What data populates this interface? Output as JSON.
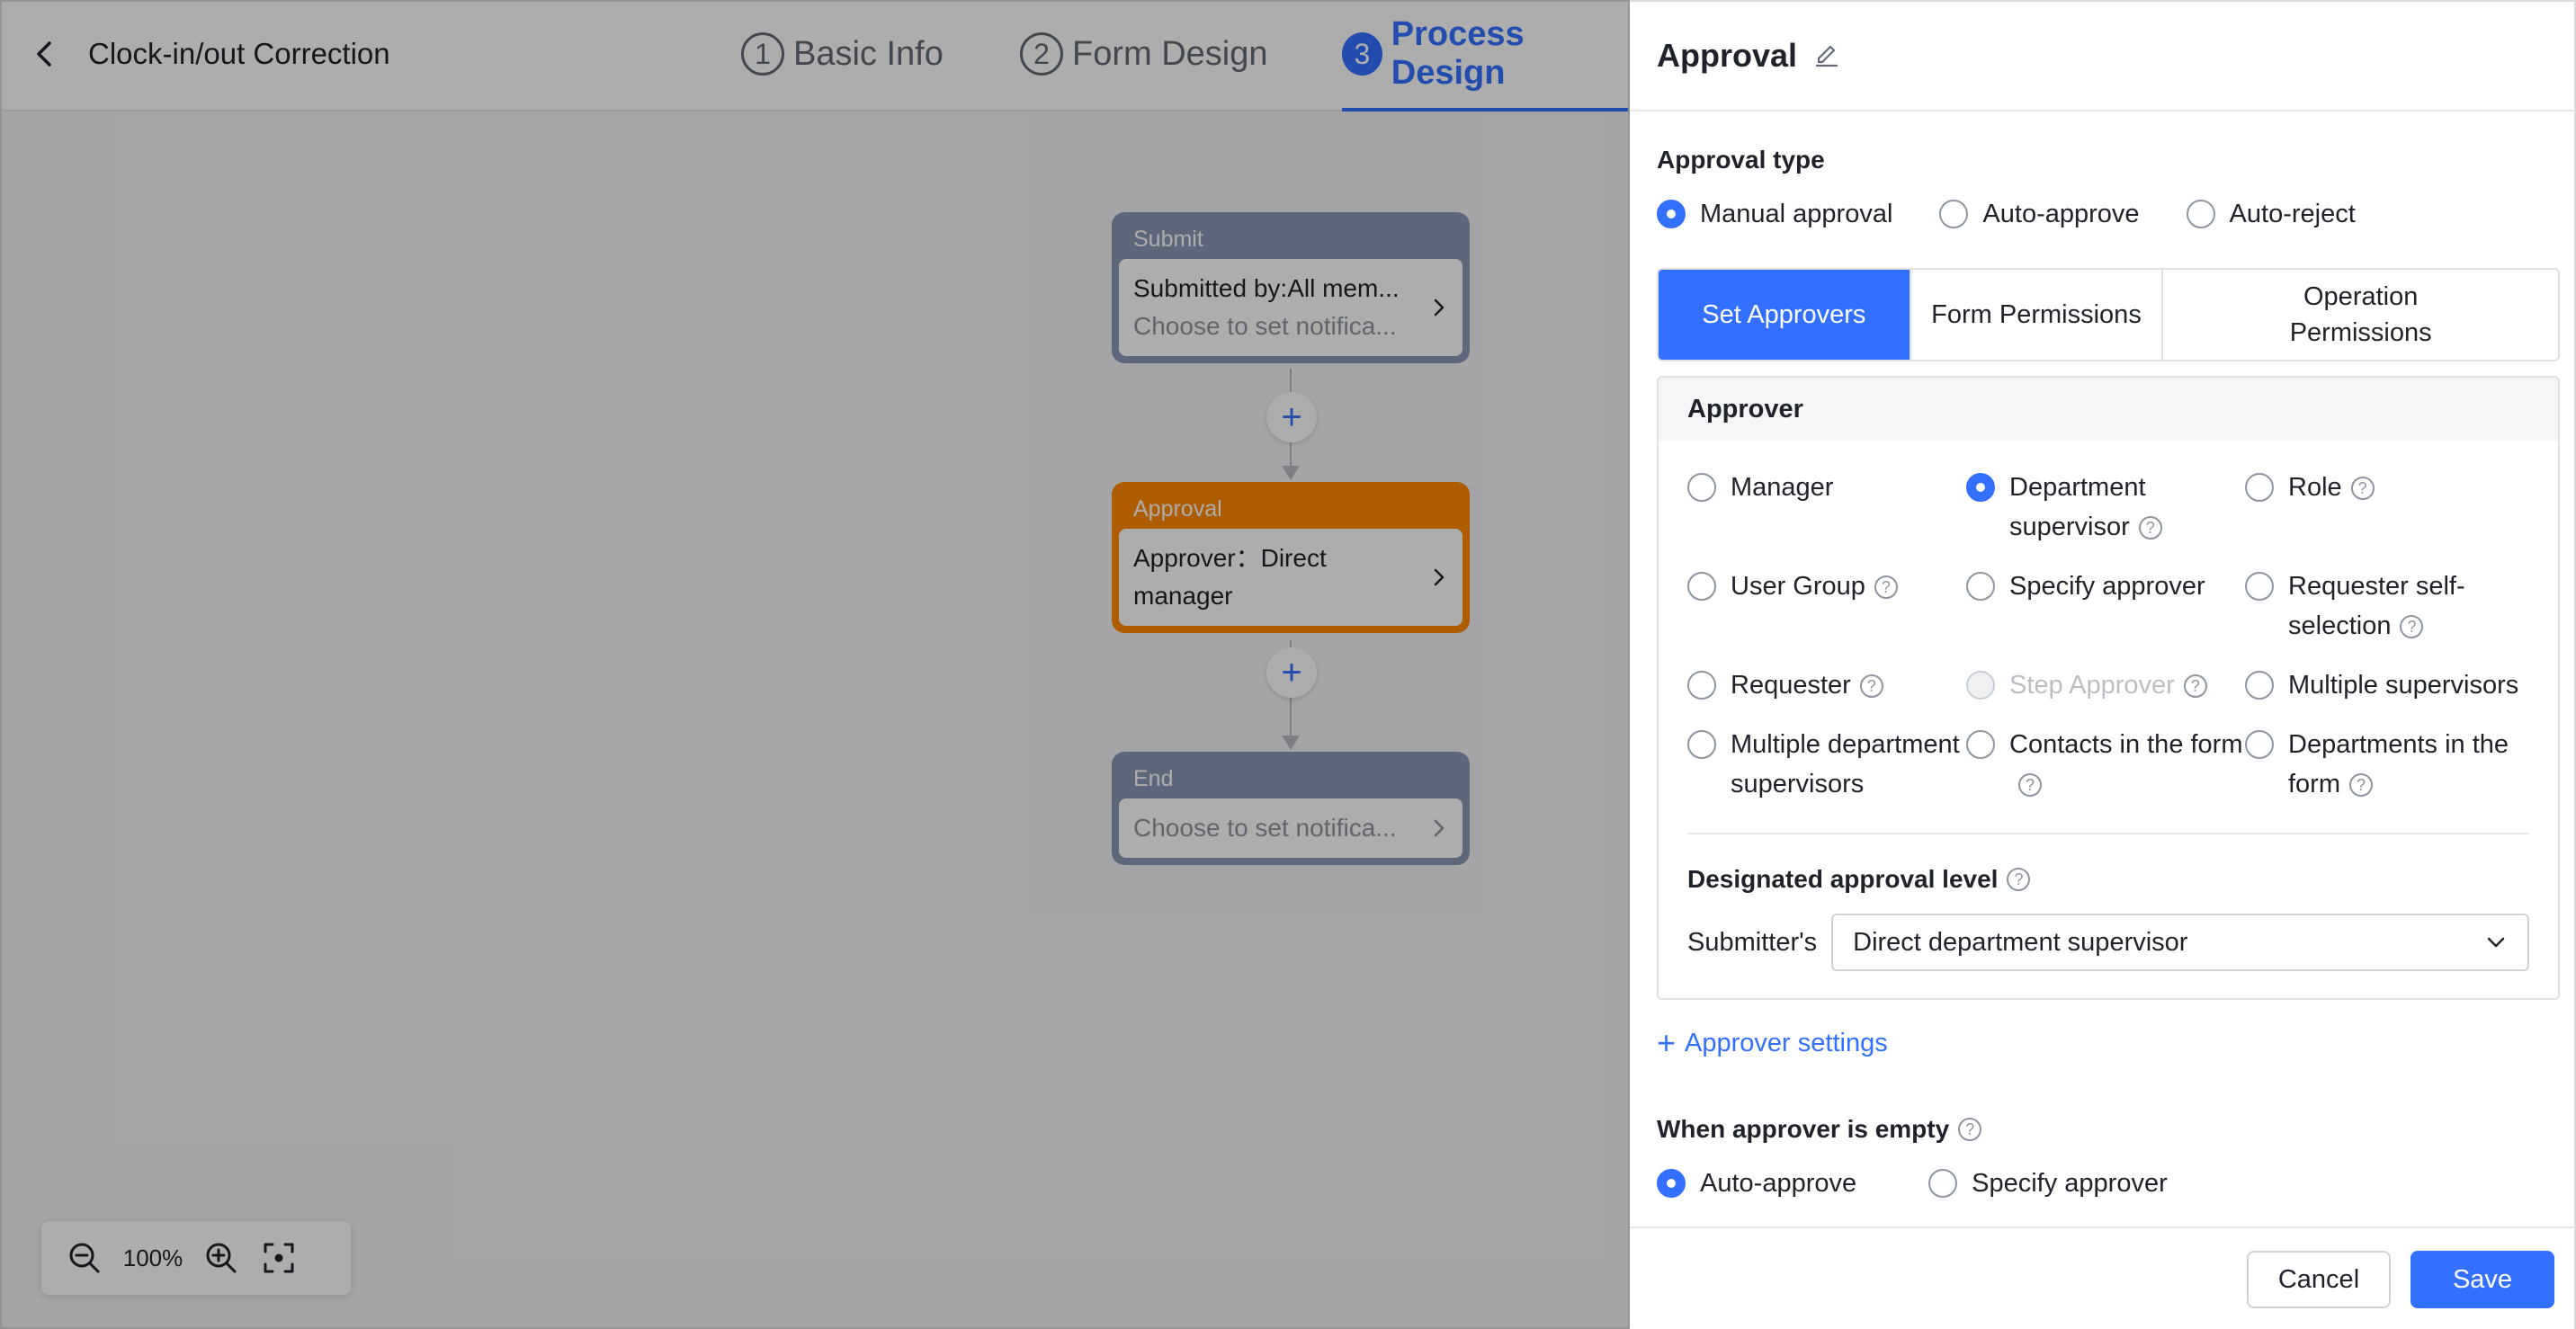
{
  "header": {
    "title": "Clock-in/out Correction",
    "steps": [
      {
        "num": "1",
        "label": "Basic Info"
      },
      {
        "num": "2",
        "label": "Form Design"
      },
      {
        "num": "3",
        "label": "Process Design"
      }
    ]
  },
  "flow": {
    "submit": {
      "head": "Submit",
      "line1": "Submitted by:All mem...",
      "line2": "Choose to set notifica..."
    },
    "approval": {
      "head": "Approval",
      "line1": "Approver：Direct manager"
    },
    "end": {
      "head": "End",
      "line1": "Choose to set notifica..."
    },
    "add_symbol": "+"
  },
  "zoom": {
    "level": "100%"
  },
  "drawer": {
    "title": "Approval",
    "approval_type": {
      "label": "Approval type",
      "options": [
        "Manual approval",
        "Auto-approve",
        "Auto-reject"
      ],
      "selected": "Manual approval"
    },
    "tabs": [
      "Set Approvers",
      "Form Permissions",
      "Operation Permissions"
    ],
    "active_tab": "Set Approvers",
    "approver": {
      "label": "Approver",
      "options": [
        "Manager",
        "Department supervisor",
        "Role",
        "User Group",
        "Specify approver",
        "Requester self-selection",
        "Requester",
        "Step Approver",
        "Multiple supervisors",
        "Multiple department supervisors",
        "Contacts in the form",
        "Departments in the form"
      ],
      "selected": "Department supervisor",
      "disabled": "Step Approver"
    },
    "level": {
      "label": "Designated approval level",
      "prefix": "Submitter's",
      "value": "Direct department supervisor"
    },
    "approver_settings_link": "Approver settings",
    "empty": {
      "label": "When approver is empty",
      "options": [
        "Auto-approve",
        "Specify approver"
      ],
      "selected": "Auto-approve"
    },
    "buttons": {
      "cancel": "Cancel",
      "save": "Save"
    }
  },
  "colors": {
    "accent": "#3370ff",
    "approval_node": "#ff8800",
    "neutral_node": "#8a99b7"
  }
}
